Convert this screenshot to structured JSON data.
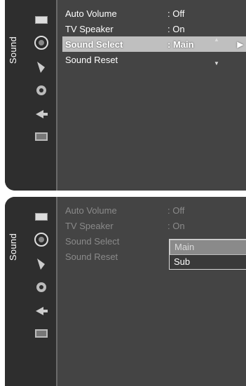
{
  "screen1": {
    "sidebar_label": "Sound",
    "items": [
      {
        "label": "Auto Volume",
        "value": ": Off"
      },
      {
        "label": "TV Speaker",
        "value": ": On"
      },
      {
        "label": "Sound Select",
        "value": ": Main",
        "arrow": "▶"
      },
      {
        "label": "Sound Reset",
        "value": ""
      }
    ]
  },
  "screen2": {
    "sidebar_label": "Sound",
    "items": [
      {
        "label": "Auto Volume",
        "value": ": Off"
      },
      {
        "label": "TV Speaker",
        "value": ": On"
      },
      {
        "label": "Sound Select",
        "value": ""
      },
      {
        "label": "Sound Reset",
        "value": ""
      }
    ],
    "options": [
      "Main",
      "Sub"
    ]
  },
  "icons": [
    "picture-icon",
    "sound-icon",
    "channel-icon",
    "setup-icon",
    "input-icon",
    "application-icon"
  ]
}
